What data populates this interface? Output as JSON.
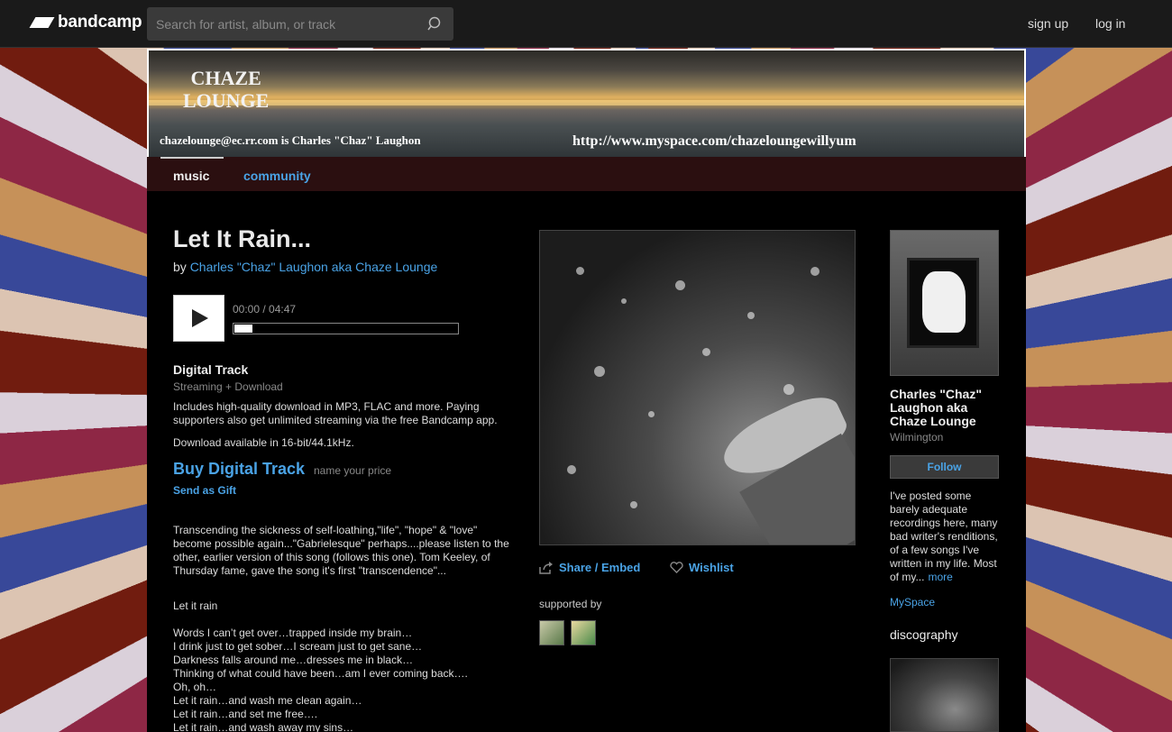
{
  "header": {
    "logo_text": "bandcamp",
    "search_placeholder": "Search for artist, album, or track",
    "signup_label": "sign up",
    "login_label": "log in"
  },
  "banner": {
    "title_line1": "CHAZE",
    "title_line2": "LOUNGE",
    "left_text": "chazelounge@ec.rr.com  is  Charles \"Chaz\" Laughon",
    "right_text": "http://www.myspace.com/chazeloungewillyum"
  },
  "tabs": {
    "music": "music",
    "community": "community"
  },
  "track": {
    "title": "Let It Rain...",
    "by_prefix": "by",
    "artist": "Charles \"Chaz\" Laughon aka Chaze Lounge",
    "time_display": "00:00 / 04:47",
    "progress": 0.08
  },
  "purchase": {
    "heading": "Digital Track",
    "sub": "Streaming + Download",
    "description": "Includes high-quality download in MP3, FLAC and more. Paying supporters also get unlimited streaming via the free Bandcamp app.",
    "bitrate": "Download available in 16-bit/44.1kHz.",
    "buy_label": "Buy Digital Track",
    "price_label": "name your price",
    "gift_label": "Send as Gift"
  },
  "about": "Transcending the sickness of self-loathing,\"life\", \"hope\" & \"love\" become possible again...\"Gabrielesque\" perhaps....please listen to the other, earlier version of this song (follows this one). Tom Keeley, of Thursday fame, gave the song it's first \"transcendence\"...",
  "lyrics": {
    "heading": "Let it rain",
    "lines": [
      "Words I can’t get over…trapped inside my brain…",
      "I drink just to get sober…I scream just to get sane…",
      "Darkness falls around me…dresses me in black…",
      "Thinking of what could have been…am I ever coming back….",
      "Oh, oh…",
      "Let it rain…and wash me clean again…",
      "Let it rain…and set me free….",
      "Let it rain…and wash away my sins…"
    ]
  },
  "actions": {
    "share_label": "Share / Embed",
    "wishlist_label": "Wishlist",
    "supported_by": "supported by"
  },
  "band": {
    "name": "Charles \"Chaz\" Laughon aka Chaze Lounge",
    "location": "Wilmington",
    "follow_label": "Follow",
    "bio": "I've posted some barely adequate recordings here, many bad writer's renditions, of a few songs I've written in my life. Most of my...",
    "more_label": "more",
    "link_label": "MySpace",
    "discography_label": "discography"
  }
}
